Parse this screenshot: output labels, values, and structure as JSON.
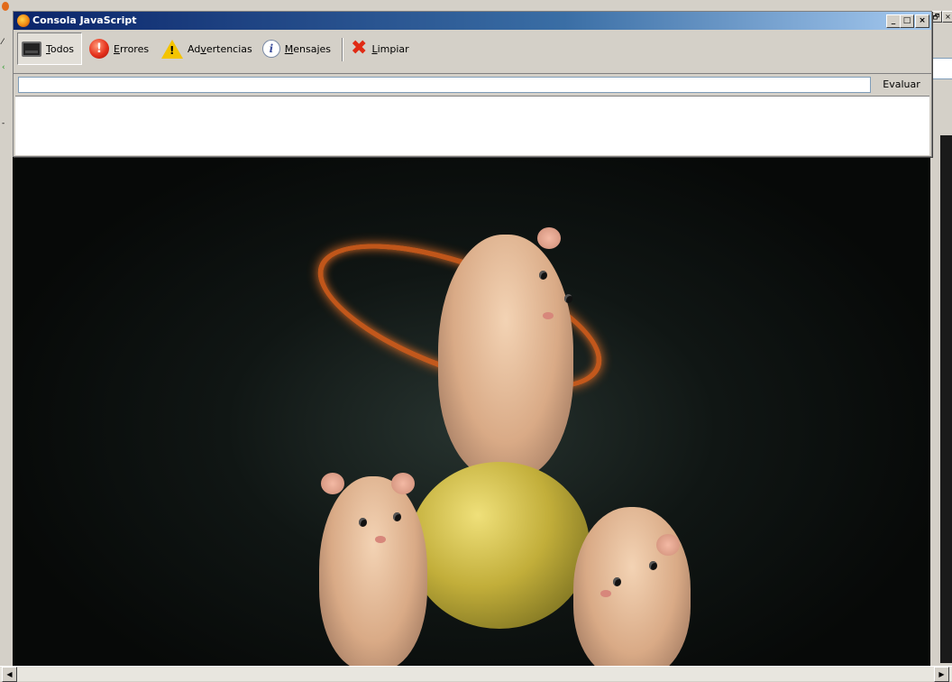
{
  "console": {
    "title": "Consola JavaScript",
    "title_buttons": {
      "minimize": "_",
      "maximize": "□",
      "close": "×"
    },
    "toolbar": {
      "all": {
        "accel": "T",
        "rest": "odos",
        "icon": "terminal-icon"
      },
      "errors": {
        "accel": "E",
        "rest": "rrores",
        "icon": "error-icon"
      },
      "warnings": {
        "pre": "Ad",
        "accel": "v",
        "rest": "ertencias",
        "icon": "warning-icon"
      },
      "messages": {
        "accel": "M",
        "rest": "ensajes",
        "icon": "info-icon"
      },
      "clear": {
        "accel": "L",
        "rest": "impiar",
        "icon": "clear-icon"
      },
      "active": "all"
    },
    "eval": {
      "value": "",
      "button": "Evaluar"
    }
  },
  "background_window": {
    "buttons": {
      "restore": "🗗",
      "close": "×"
    },
    "scroll_left": "◀",
    "scroll_right": "▶"
  },
  "colors": {
    "title_start": "#0a246a",
    "title_end": "#a6caf0",
    "ring": "#e0621c",
    "error": "#e5311c",
    "warning": "#f4c400"
  }
}
